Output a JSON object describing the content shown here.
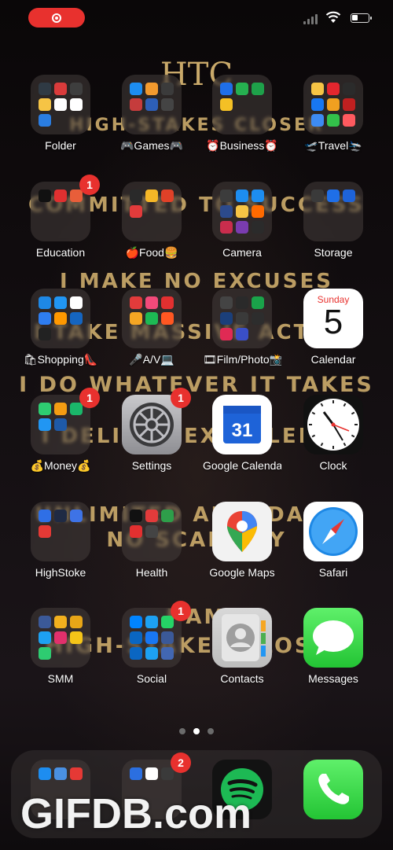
{
  "wallpaper": {
    "logo_letters": "HTC",
    "brand_line": "HIGH-STAKES CLOSER",
    "lines": [
      "COMMITTED TO SUCCESS",
      "I MAKE NO EXCUSES",
      "I TAKE MASSIVE ACTION",
      "I DO WHATEVER IT TAKES",
      "I DELIVER EXCELLENCE",
      "UNLIMITED ABUNDANCE",
      "NO SCARCITY",
      "I AM",
      "HIGH-STAKES CLOSER"
    ]
  },
  "status_bar": {
    "recording": true,
    "battery_percent": 35
  },
  "apps": [
    {
      "id": "folder",
      "label": "Folder",
      "kind": "folder",
      "minis": [
        "#2f3a44",
        "#d93b3b",
        "#3e3e3e",
        "#f6c445",
        "#ffffff",
        "#ffffff",
        "#2a7de1",
        "#000000",
        "#000000"
      ]
    },
    {
      "id": "games",
      "label": "🎮Games🎮",
      "kind": "folder",
      "minis": [
        "#1d8df0",
        "#f29a2e",
        "#3b3b3b",
        "#c53c3c",
        "#2d5fb8",
        "#444444",
        "#000000",
        "#000000",
        "#000000"
      ]
    },
    {
      "id": "business",
      "label": "⏰Business⏰",
      "kind": "folder",
      "minis": [
        "#1f6fe8",
        "#26b050",
        "#1ea14a",
        "#f4c025",
        "#000000",
        "#000000",
        "#000000",
        "#000000",
        "#000000"
      ]
    },
    {
      "id": "travel",
      "label": "🛫Travel🛬",
      "kind": "folder",
      "minis": [
        "#f6c445",
        "#e3262e",
        "#2b2b2b",
        "#1877f2",
        "#f0a020",
        "#c02020",
        "#3d8bf2",
        "#33c14a",
        "#ff5a5f"
      ]
    },
    {
      "id": "education",
      "label": "Education",
      "kind": "folder",
      "badge": "1",
      "minis": [
        "#111111",
        "#e03030",
        "#e85e3a",
        "#000000",
        "#000000",
        "#000000",
        "#000000",
        "#000000",
        "#000000"
      ]
    },
    {
      "id": "food",
      "label": "🍎Food🍔",
      "kind": "folder",
      "minis": [
        "#2a2a2a",
        "#f5b727",
        "#e04128",
        "#e23b3b",
        "#000000",
        "#000000",
        "#000000",
        "#000000",
        "#000000"
      ]
    },
    {
      "id": "camera",
      "label": "Camera",
      "kind": "folder",
      "minis": [
        "#3c3c3c",
        "#1d8df0",
        "#1d8df0",
        "#2c4a8c",
        "#f6c445",
        "#ff6a00",
        "#c92d4d",
        "#7a3cb0",
        "#2b2b2b"
      ]
    },
    {
      "id": "storage",
      "label": "Storage",
      "kind": "folder",
      "minis": [
        "#3a3a3a",
        "#1f6fe8",
        "#1e63d8",
        "#000000",
        "#000000",
        "#000000",
        "#000000",
        "#000000",
        "#000000"
      ]
    },
    {
      "id": "shopping",
      "label": "🛍Shopping👠",
      "kind": "folder",
      "minis": [
        "#1e88e5",
        "#2196f3",
        "#ffffff",
        "#2e7df0",
        "#ff9800",
        "#1565c0",
        "#222222",
        "#000000",
        "#000000"
      ]
    },
    {
      "id": "av",
      "label": "🎤A/V💻",
      "kind": "folder",
      "minis": [
        "#e23b3b",
        "#f24a7a",
        "#e23030",
        "#f5a623",
        "#1db954",
        "#ff5722",
        "#000000",
        "#000000",
        "#000000"
      ]
    },
    {
      "id": "filmphoto",
      "label": "🎞Film/Photo📸",
      "kind": "folder",
      "minis": [
        "#444444",
        "#2a2a2a",
        "#1aa34a",
        "#1b3f7a",
        "#3a3a3a",
        "#2d2d2d",
        "#e02a54",
        "#3a4fc7",
        "#000000"
      ]
    },
    {
      "id": "money",
      "label": "💰Money💰",
      "kind": "folder",
      "badge": "1",
      "minis": [
        "#2ecc71",
        "#f39c12",
        "#1ab76a",
        "#2196f3",
        "#1e5aa8",
        "#000000",
        "#000000",
        "#000000",
        "#000000"
      ]
    },
    {
      "id": "highstoke",
      "label": "HighStoke",
      "kind": "folder",
      "minis": [
        "#2f6fe6",
        "#1f2a44",
        "#3e73e6",
        "#e53935",
        "#000000",
        "#000000",
        "#000000",
        "#000000",
        "#000000"
      ]
    },
    {
      "id": "health",
      "label": "Health",
      "kind": "folder",
      "minis": [
        "#111111",
        "#e23b3b",
        "#2e9e4a",
        "#e23030",
        "#444444",
        "#000000",
        "#000000",
        "#000000",
        "#000000"
      ]
    },
    {
      "id": "smm",
      "label": "SMM",
      "kind": "folder",
      "minis": [
        "#3b5998",
        "#f2b01e",
        "#e8a617",
        "#1da1f2",
        "#e1306c",
        "#f5c518",
        "#2ecc71",
        "#000000",
        "#000000"
      ]
    },
    {
      "id": "social",
      "label": "Social",
      "kind": "folder",
      "badge": "1",
      "minis": [
        "#0084ff",
        "#1da1f2",
        "#25d366",
        "#0a66c2",
        "#1877f2",
        "#3b5998",
        "#0a66c2",
        "#1da1f2",
        "#4267b2"
      ]
    },
    {
      "id": "settings",
      "label": "Settings",
      "kind": "settings",
      "badge": "1"
    },
    {
      "id": "google-calendar",
      "label": "Google Calendar",
      "kind": "gcal",
      "day": "31"
    },
    {
      "id": "clock",
      "label": "Clock",
      "kind": "clock"
    },
    {
      "id": "calendar",
      "label": "Calendar",
      "kind": "calendar",
      "weekday": "Sunday",
      "day": "5"
    },
    {
      "id": "google-maps",
      "label": "Google Maps",
      "kind": "maps"
    },
    {
      "id": "safari",
      "label": "Safari",
      "kind": "safari"
    },
    {
      "id": "contacts",
      "label": "Contacts",
      "kind": "contacts"
    },
    {
      "id": "messages",
      "label": "Messages",
      "kind": "messages"
    }
  ],
  "dock": {
    "apps": [
      {
        "id": "dock-folder-1",
        "kind": "folder",
        "minis": [
          "#1d8df0",
          "#4a90e2",
          "#e53935",
          "#000000",
          "#000000",
          "#000000",
          "#000000",
          "#000000",
          "#000000"
        ]
      },
      {
        "id": "dock-folder-2",
        "kind": "folder",
        "badge": "2",
        "minis": [
          "#2b6fe0",
          "#ffffff",
          "#3a3a3a",
          "#000000",
          "#000000",
          "#000000",
          "#000000",
          "#000000",
          "#000000"
        ]
      },
      {
        "id": "spotify",
        "kind": "spotify"
      },
      {
        "id": "phone",
        "kind": "phone"
      }
    ]
  },
  "pages": {
    "count": 3,
    "current": 2
  },
  "watermark": "GIFDB.com"
}
